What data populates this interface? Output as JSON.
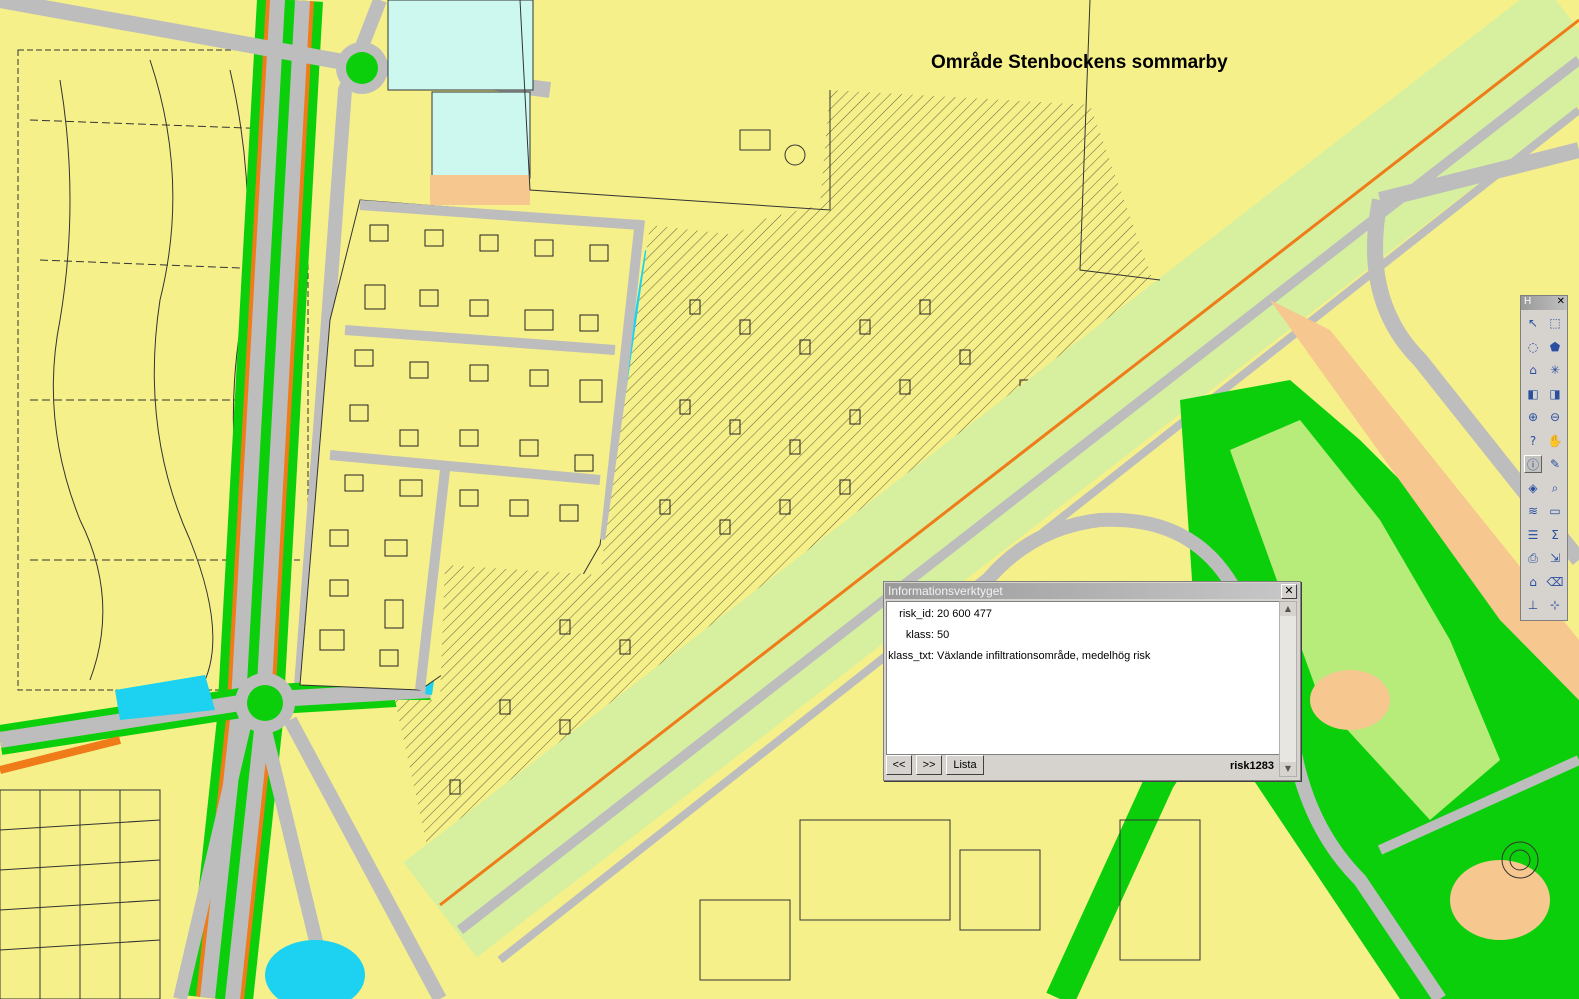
{
  "map": {
    "area_label": "Område Stenbockens sommarby",
    "palette": {
      "residential": "#f7f28c",
      "road": "#bdbdbd",
      "green": "#1ed41e",
      "light_green": "#b7ec7a",
      "orange": "#ee7a1b",
      "water": "#1cd2f0",
      "pale_water": "#ccf8f0",
      "tan": "#f6c78f"
    }
  },
  "info_window": {
    "title": "Informationsverktyget",
    "close_glyph": "✕",
    "fields": [
      {
        "key": "risk_id:",
        "value": "20 600 477"
      },
      {
        "key": "klass:",
        "value": "50"
      },
      {
        "key": "klass_txt:",
        "value": "Växlande infiltrationsområde, medelhög risk"
      }
    ],
    "buttons": {
      "prev": "<<",
      "next": ">>",
      "list": "Lista"
    },
    "layer_id": "risk1283"
  },
  "toolbar": {
    "title": "H",
    "close_glyph": "✕",
    "tools": [
      {
        "icon": "select-arrow-icon",
        "glyph": "↖"
      },
      {
        "icon": "select-rect-icon",
        "glyph": "⬚"
      },
      {
        "icon": "select-circle-icon",
        "glyph": "◌"
      },
      {
        "icon": "select-polygon-icon",
        "glyph": "⬟"
      },
      {
        "icon": "home-icon",
        "glyph": "⌂"
      },
      {
        "icon": "refresh-icon",
        "glyph": "✳"
      },
      {
        "icon": "back-icon",
        "glyph": "◧"
      },
      {
        "icon": "forward-icon",
        "glyph": "◨"
      },
      {
        "icon": "zoom-in-icon",
        "glyph": "⊕"
      },
      {
        "icon": "zoom-out-icon",
        "glyph": "⊖"
      },
      {
        "icon": "query-icon",
        "glyph": "?"
      },
      {
        "icon": "pan-hand-icon",
        "glyph": "✋"
      },
      {
        "icon": "info-icon",
        "glyph": "ⓘ"
      },
      {
        "icon": "measure-icon",
        "glyph": "✎"
      },
      {
        "icon": "label-icon",
        "glyph": "◈"
      },
      {
        "icon": "identify-icon",
        "glyph": "⌕"
      },
      {
        "icon": "layers-icon",
        "glyph": "≋"
      },
      {
        "icon": "ruler-icon",
        "glyph": "▭"
      },
      {
        "icon": "legend-icon",
        "glyph": "☰"
      },
      {
        "icon": "sum-icon",
        "glyph": "Σ"
      },
      {
        "icon": "print-icon",
        "glyph": "⎙"
      },
      {
        "icon": "export-icon",
        "glyph": "⇲"
      },
      {
        "icon": "redline-icon",
        "glyph": "⌂"
      },
      {
        "icon": "erase-icon",
        "glyph": "⌫"
      },
      {
        "icon": "scalebar-icon",
        "glyph": "⊥"
      },
      {
        "icon": "crosshair-icon",
        "glyph": "⊹"
      }
    ]
  }
}
